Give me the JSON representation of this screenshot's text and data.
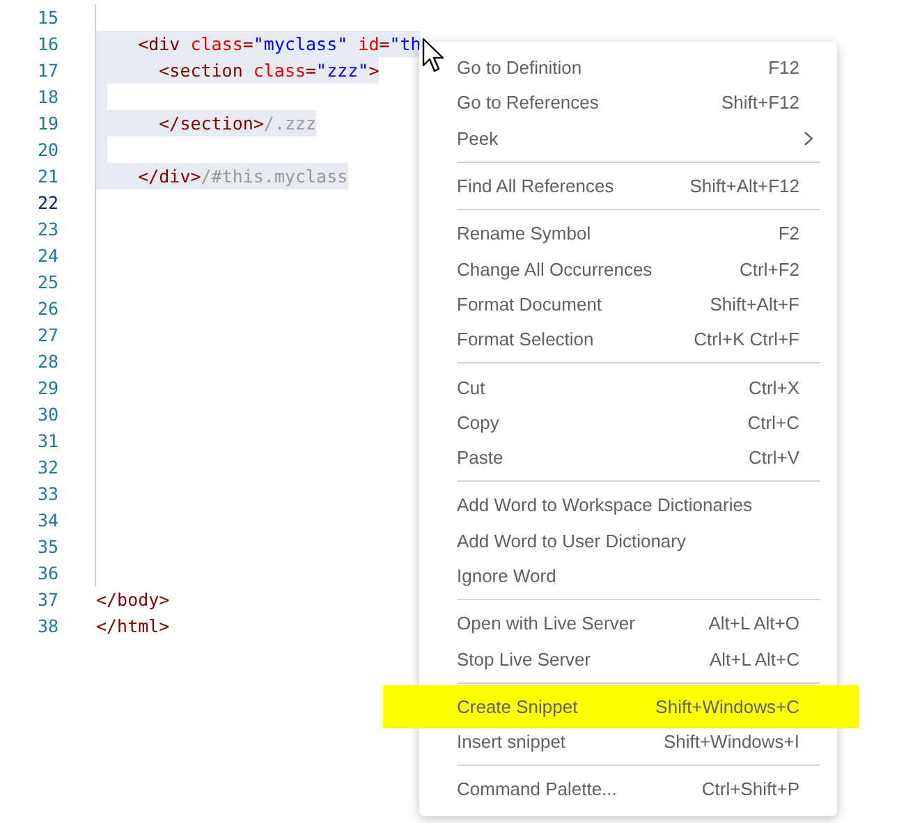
{
  "editor": {
    "lines": [
      {
        "number": "15",
        "current": false,
        "selected": false
      },
      {
        "number": "16",
        "current": false,
        "selected": true,
        "tokens": [
          {
            "kind": "tag",
            "text": "    <div"
          },
          {
            "kind": "attr",
            "text": " class"
          },
          {
            "kind": "tag",
            "text": "="
          },
          {
            "kind": "value",
            "text": "\"myclass\""
          },
          {
            "kind": "attr",
            "text": " id"
          },
          {
            "kind": "tag",
            "text": "="
          },
          {
            "kind": "value",
            "text": "\"th"
          }
        ]
      },
      {
        "number": "17",
        "current": false,
        "selected": true,
        "tokens": [
          {
            "kind": "tag",
            "text": "      <section"
          },
          {
            "kind": "attr",
            "text": " class"
          },
          {
            "kind": "tag",
            "text": "="
          },
          {
            "kind": "value",
            "text": "\"zzz\""
          },
          {
            "kind": "tag",
            "text": ">"
          }
        ]
      },
      {
        "number": "18",
        "current": false,
        "selected": true
      },
      {
        "number": "19",
        "current": false,
        "selected": true,
        "tokens": [
          {
            "kind": "tag",
            "text": "      </section>"
          },
          {
            "kind": "hint",
            "text": "/.zzz"
          }
        ]
      },
      {
        "number": "20",
        "current": false,
        "selected": true
      },
      {
        "number": "21",
        "current": false,
        "selected": true,
        "tokens": [
          {
            "kind": "tag",
            "text": "    </div>"
          },
          {
            "kind": "hint",
            "text": "/#this.myclass"
          }
        ]
      },
      {
        "number": "22",
        "current": true,
        "selected": false
      },
      {
        "number": "23",
        "current": false,
        "selected": false
      },
      {
        "number": "24",
        "current": false,
        "selected": false
      },
      {
        "number": "25",
        "current": false,
        "selected": false
      },
      {
        "number": "26",
        "current": false,
        "selected": false
      },
      {
        "number": "27",
        "current": false,
        "selected": false
      },
      {
        "number": "28",
        "current": false,
        "selected": false
      },
      {
        "number": "29",
        "current": false,
        "selected": false
      },
      {
        "number": "30",
        "current": false,
        "selected": false
      },
      {
        "number": "31",
        "current": false,
        "selected": false
      },
      {
        "number": "32",
        "current": false,
        "selected": false
      },
      {
        "number": "33",
        "current": false,
        "selected": false
      },
      {
        "number": "34",
        "current": false,
        "selected": false
      },
      {
        "number": "35",
        "current": false,
        "selected": false
      },
      {
        "number": "36",
        "current": false,
        "selected": false
      },
      {
        "number": "37",
        "current": false,
        "selected": false,
        "tokens": [
          {
            "kind": "tag",
            "text": "</body>"
          }
        ]
      },
      {
        "number": "38",
        "current": false,
        "selected": false,
        "tokens": [
          {
            "kind": "tag",
            "text": "</html>"
          }
        ]
      }
    ]
  },
  "context_menu": {
    "groups": [
      [
        {
          "label": "Go to Definition",
          "shortcut": "F12",
          "submenu": false,
          "highlighted": false
        },
        {
          "label": "Go to References",
          "shortcut": "Shift+F12",
          "submenu": false,
          "highlighted": false
        },
        {
          "label": "Peek",
          "submenu": true,
          "highlighted": false
        }
      ],
      [
        {
          "label": "Find All References",
          "shortcut": "Shift+Alt+F12",
          "submenu": false,
          "highlighted": false
        }
      ],
      [
        {
          "label": "Rename Symbol",
          "shortcut": "F2",
          "submenu": false,
          "highlighted": false
        },
        {
          "label": "Change All Occurrences",
          "shortcut": "Ctrl+F2",
          "submenu": false,
          "highlighted": false
        },
        {
          "label": "Format Document",
          "shortcut": "Shift+Alt+F",
          "submenu": false,
          "highlighted": false
        },
        {
          "label": "Format Selection",
          "shortcut": "Ctrl+K Ctrl+F",
          "submenu": false,
          "highlighted": false
        }
      ],
      [
        {
          "label": "Cut",
          "shortcut": "Ctrl+X",
          "submenu": false,
          "highlighted": false
        },
        {
          "label": "Copy",
          "shortcut": "Ctrl+C",
          "submenu": false,
          "highlighted": false
        },
        {
          "label": "Paste",
          "shortcut": "Ctrl+V",
          "submenu": false,
          "highlighted": false
        }
      ],
      [
        {
          "label": "Add Word to Workspace Dictionaries",
          "submenu": false,
          "highlighted": false
        },
        {
          "label": "Add Word to User Dictionary",
          "submenu": false,
          "highlighted": false
        },
        {
          "label": "Ignore Word",
          "submenu": false,
          "highlighted": false
        }
      ],
      [
        {
          "label": "Open with Live Server",
          "shortcut": "Alt+L Alt+O",
          "submenu": false,
          "highlighted": false
        },
        {
          "label": "Stop Live Server",
          "shortcut": "Alt+L Alt+C",
          "submenu": false,
          "highlighted": false
        }
      ],
      [
        {
          "label": "Create Snippet",
          "shortcut": "Shift+Windows+C",
          "submenu": false,
          "highlighted": true
        },
        {
          "label": "Insert snippet",
          "shortcut": "Shift+Windows+I",
          "submenu": false,
          "highlighted": false
        }
      ],
      [
        {
          "label": "Command Palette...",
          "shortcut": "Ctrl+Shift+P",
          "submenu": false,
          "highlighted": false
        }
      ]
    ]
  }
}
